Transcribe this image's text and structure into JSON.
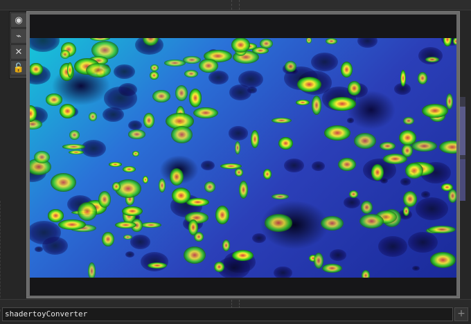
{
  "toolbar": {
    "buttons": [
      {
        "name": "viewer-active-toggle",
        "icon": "target-icon",
        "glyph": "◉"
      },
      {
        "name": "link-toggle",
        "icon": "link-icon",
        "glyph": "⌁"
      },
      {
        "name": "close-toggle",
        "icon": "close-icon",
        "glyph": "✕"
      },
      {
        "name": "lock-toggle",
        "icon": "lock-icon",
        "glyph": "🔓"
      }
    ]
  },
  "node": {
    "name": "shadertoyConverter",
    "add_glyph": "+"
  },
  "colors": {
    "background": "#262626",
    "viewer_frame": "#6a6a6a",
    "shader_cyan": "#16c6d8",
    "shader_blue": "#2b3fb8",
    "shader_green": "#33cc22",
    "shader_yellow": "#ffee33",
    "shader_red": "#d9443a"
  }
}
